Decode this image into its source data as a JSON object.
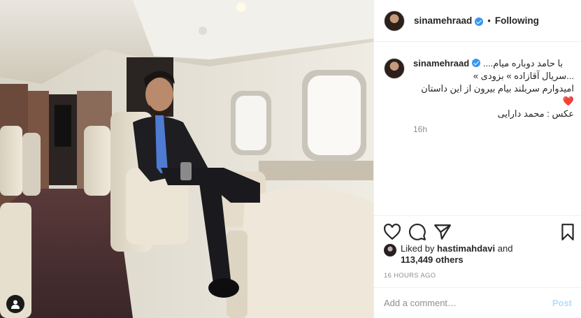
{
  "post": {
    "username": "sinamehraad",
    "follow_status": "Following",
    "dot": "•",
    "caption_lines": [
      "با حامد دوباره میام....",
      "...سریال آقازاده » بزودی »",
      "امیدوارم سربلند بیام بیرون از این داستان",
      "❤️",
      "عکس : محمد دارایی"
    ],
    "caption_time": "16h",
    "liked_by_prefix": "Liked by",
    "liked_by_user": "hastimahdavi",
    "liked_by_and": "and",
    "likes_count_text": "113,449 others",
    "time_ago": "16 HOURS AGO",
    "comment_placeholder": "Add a comment…",
    "post_label": "Post"
  },
  "icons": {
    "verified": "verified-badge-icon",
    "like": "heart-icon",
    "comment": "comment-icon",
    "share": "paper-plane-icon",
    "save": "bookmark-icon",
    "tag": "user-tag-icon",
    "options": "more-options-icon"
  },
  "colors": {
    "verified_blue": "#3897f0",
    "post_button": "#b2dffc",
    "muted_text": "#8e8e8e",
    "heart": "#c0121a"
  }
}
